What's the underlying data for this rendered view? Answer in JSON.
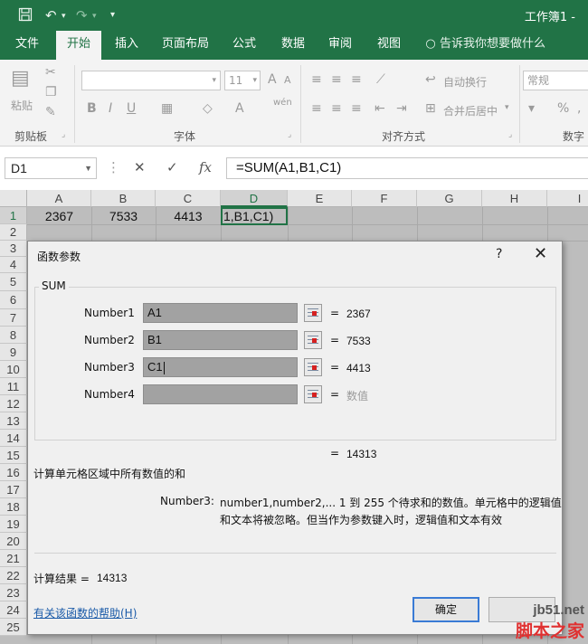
{
  "window": {
    "title": "工作簿1 -"
  },
  "qat": {
    "save": "save",
    "undo": "undo",
    "redo": "redo",
    "more": "more"
  },
  "tabs": [
    {
      "label": "文件"
    },
    {
      "label": "开始"
    },
    {
      "label": "插入"
    },
    {
      "label": "页面布局"
    },
    {
      "label": "公式"
    },
    {
      "label": "数据"
    },
    {
      "label": "审阅"
    },
    {
      "label": "视图"
    },
    {
      "label": "告诉我你想要做什么"
    }
  ],
  "ribbon": {
    "clipboard": {
      "label": "剪贴板",
      "paste": "粘贴"
    },
    "font": {
      "label": "字体",
      "size": "11"
    },
    "alignment": {
      "label": "对齐方式",
      "wrap": "自动换行",
      "merge": "合并后居中"
    },
    "number": {
      "label": "数字",
      "format": "常规"
    }
  },
  "formula_bar": {
    "name_box": "D1",
    "formula": "=SUM(A1,B1,C1)"
  },
  "sheet": {
    "columns": [
      "A",
      "B",
      "C",
      "D",
      "E",
      "F",
      "G",
      "H",
      "I"
    ],
    "rows": [
      "1",
      "2",
      "3",
      "4",
      "5",
      "6",
      "7",
      "8",
      "9",
      "10",
      "11",
      "12",
      "13",
      "14",
      "15",
      "16",
      "17",
      "18",
      "19",
      "20",
      "21",
      "22",
      "23",
      "24",
      "25"
    ],
    "cells": {
      "A1": "2367",
      "B1": "7533",
      "C1": "4413",
      "D1": "1,B1,C1)"
    }
  },
  "dialog": {
    "title": "函数参数",
    "help_glyph": "?",
    "close_glyph": "✕",
    "function_name": "SUM",
    "args": [
      {
        "label": "Number1",
        "value": "A1",
        "result": "2367"
      },
      {
        "label": "Number2",
        "value": "B1",
        "result": "7533"
      },
      {
        "label": "Number3",
        "value": "C1",
        "result": "4413"
      },
      {
        "label": "Number4",
        "value": "",
        "result": "数值"
      }
    ],
    "eq": "=",
    "total": "14313",
    "description": "计算单元格区域中所有数值的和",
    "arg_help_label": "Number3:",
    "arg_help_line1": "number1,number2,...  1 到 255 个待求和的数值。单元格中的逻辑值",
    "arg_help_line2": "和文本将被忽略。但当作为参数键入时，逻辑值和文本有效",
    "result_label": "计算结果 =",
    "result_value": "14313",
    "help_link": "有关该函数的帮助(H)",
    "ok": "确定",
    "cancel": ""
  },
  "watermark": {
    "site": "jb51.net",
    "brand": "脚本之家"
  },
  "colors": {
    "excel_green": "#217346",
    "sheet_shade": "#bdbdbd",
    "dialog_bg": "#f0f0f0",
    "link": "#1a5aa8"
  }
}
